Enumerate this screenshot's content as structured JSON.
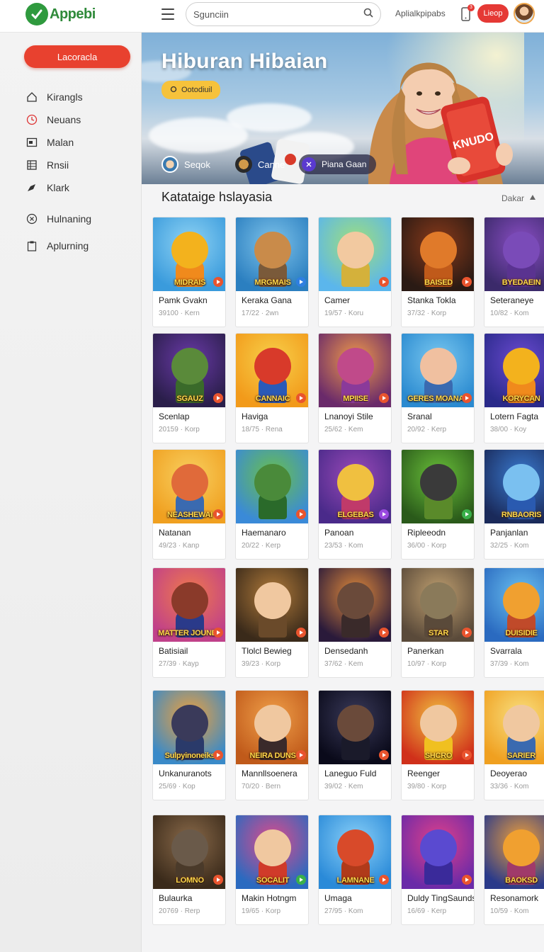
{
  "header": {
    "logo_text": "Appebi",
    "search_placeholder": "Sgunciin",
    "link_text": "Aplialkpipabs",
    "notif_count": "3",
    "button_label": "Lieop"
  },
  "sidebar": {
    "cta_label": "Lacoracla",
    "items": [
      {
        "label": "Kirangls",
        "icon": "home-icon"
      },
      {
        "label": "Neuans",
        "icon": "clock-icon"
      },
      {
        "label": "Malan",
        "icon": "window-icon"
      },
      {
        "label": "Rnsii",
        "icon": "grid-icon"
      },
      {
        "label": "Klark",
        "icon": "tag-icon"
      },
      {
        "label": "Hulnaning",
        "icon": "x-circle-icon"
      },
      {
        "label": "Aplurning",
        "icon": "clipboard-icon"
      }
    ]
  },
  "hero": {
    "title": "Hiburan Hibaian",
    "badge": "Ootodiuil",
    "phone_text": "KNUDO",
    "chips": [
      "Seqok",
      "Canne",
      "Piana Gaan"
    ]
  },
  "section": {
    "title": "Katataige hslayasia",
    "more_label": "Dakar"
  },
  "games": [
    {
      "name": "Pamk Gvakn",
      "meta": "39100 · Kern",
      "art": "MIDRAIS",
      "c1": "#3a9bdc",
      "c2": "#8fd3f4",
      "fig": "#f3b21d",
      "body": "#f08a1c",
      "play": "#e9542e"
    },
    {
      "name": "Keraka Gana",
      "meta": "17/22 · 2wn",
      "art": "MRGMAIS",
      "c1": "#2b7fc0",
      "c2": "#7ec3ea",
      "fig": "#c98b4a",
      "body": "#7a5a3a",
      "play": "#2f7fe0"
    },
    {
      "name": "Camer",
      "meta": "19/57 · Koru",
      "art": "",
      "c1": "#5bb6ec",
      "c2": "#9fdf7a",
      "fig": "#f2c9a0",
      "body": "#d4b13b",
      "play": "#e9542e"
    },
    {
      "name": "Stanka Tokla",
      "meta": "37/32 · Korp",
      "art": "BAISED",
      "c1": "#2a1a14",
      "c2": "#8a3a1a",
      "fig": "#e07a2a",
      "body": "#c05a1a",
      "play": "#e9542e"
    },
    {
      "name": "Seteraneye",
      "meta": "10/82 · Kom",
      "art": "BYEDAEIN",
      "c1": "#3b2a6a",
      "c2": "#8a4ec4",
      "fig": "#7a4bb8",
      "body": "#5a3390",
      "play": "#7a4be0"
    },
    {
      "name": "Scenlap",
      "meta": "20159 · Korp",
      "art": "SGAUZ",
      "c1": "#2a1e4a",
      "c2": "#6a3aa8",
      "fig": "#5a8a3a",
      "body": "#3a6a2a",
      "play": "#e9542e"
    },
    {
      "name": "Haviga",
      "meta": "18/75 · Rena",
      "art": "CANNAIC",
      "c1": "#f29a1a",
      "c2": "#f7d04a",
      "fig": "#d83a2a",
      "body": "#2a5ab8",
      "play": "#e9542e"
    },
    {
      "name": "Lnanoyi Stile",
      "meta": "25/62 · Kem",
      "art": "MPIISE",
      "c1": "#6a2a6a",
      "c2": "#f09a4a",
      "fig": "#c04a8a",
      "body": "#8a3a9a",
      "play": "#e9542e"
    },
    {
      "name": "Sranal",
      "meta": "20/92 · Kerp",
      "art": "GERES MOANAN",
      "c1": "#2a8ad0",
      "c2": "#7ac8f0",
      "fig": "#f0c0a0",
      "body": "#3a6ab0",
      "play": "#e9542e"
    },
    {
      "name": "Lotern Fagta",
      "meta": "38/00 · Koy",
      "art": "KORYCAN",
      "c1": "#2a2a8a",
      "c2": "#6a4ad0",
      "fig": "#f3b21d",
      "body": "#f08a1c",
      "play": "#e9542e"
    },
    {
      "name": "Natanan",
      "meta": "49/23 · Kanp",
      "art": "NEASHEWAI",
      "c1": "#f0a020",
      "c2": "#f8d060",
      "fig": "#e06a3a",
      "body": "#3a6ab0",
      "play": "#e9542e"
    },
    {
      "name": "Haemanaro",
      "meta": "20/22 · Kerp",
      "art": "",
      "c1": "#3a8ad8",
      "c2": "#6ac04a",
      "fig": "#4a8a3a",
      "body": "#2a6a2a",
      "play": "#e9542e"
    },
    {
      "name": "Panoan",
      "meta": "23/53 · Kom",
      "art": "ELGEBAS",
      "c1": "#4a2a8a",
      "c2": "#9a4ab8",
      "fig": "#f0c040",
      "body": "#c03a6a",
      "play": "#9a4ae0"
    },
    {
      "name": "Ripleeodn",
      "meta": "36/00 · Korp",
      "art": "",
      "c1": "#2a5a1a",
      "c2": "#6ac03a",
      "fig": "#3a3a3a",
      "body": "#5a8a2a",
      "play": "#3ab04a"
    },
    {
      "name": "Panjanlan",
      "meta": "32/25 · Kom",
      "art": "RNBAORIS",
      "c1": "#1a2a5a",
      "c2": "#3a7ad0",
      "fig": "#7ac0f0",
      "body": "#2a5ab0",
      "play": "#e9542e"
    },
    {
      "name": "Batisiail",
      "meta": "27/39 · Kayp",
      "art": "MATTER JOUNES",
      "c1": "#c0408a",
      "c2": "#f07a4a",
      "fig": "#8a3a2a",
      "body": "#2a3a8a",
      "play": "#e9542e"
    },
    {
      "name": "Tlolcl Bewieg",
      "meta": "39/23 · Korp",
      "art": "",
      "c1": "#3a2a1a",
      "c2": "#b07a3a",
      "fig": "#f0c8a0",
      "body": "#6a4a2a",
      "play": "#e9542e"
    },
    {
      "name": "Densedanh",
      "meta": "37/62 · Kem",
      "art": "",
      "c1": "#2a1a3a",
      "c2": "#e08a3a",
      "fig": "#6a4a3a",
      "body": "#3a2a2a",
      "play": "#e9542e"
    },
    {
      "name": "Panerkan",
      "meta": "10/97 · Korp",
      "art": "STAR",
      "c1": "#5a4a3a",
      "c2": "#c0a070",
      "fig": "#8a7a5a",
      "body": "#5a4a3a",
      "play": "#e9542e"
    },
    {
      "name": "Svarrala",
      "meta": "37/39 · Kom",
      "art": "DUISIDIE",
      "c1": "#2a6ac0",
      "c2": "#6ac0f0",
      "fig": "#f0a030",
      "body": "#c04a2a",
      "play": "#e9542e"
    },
    {
      "name": "Unkanuranots",
      "meta": "25/69 · Kop",
      "art": "Sulpyinoneiks",
      "c1": "#3a8ac8",
      "c2": "#f0a03a",
      "fig": "#3a3a5a",
      "body": "#2a3a6a",
      "play": "#e9542e"
    },
    {
      "name": "Mannllsoenera",
      "meta": "70/20 · Bern",
      "art": "NEIRA DUNS",
      "c1": "#c05a1a",
      "c2": "#f0a04a",
      "fig": "#f0c8a0",
      "body": "#3a2a2a",
      "play": "#e9542e"
    },
    {
      "name": "Laneguo Fuld",
      "meta": "39/02 · Kem",
      "art": "",
      "c1": "#0a0a1a",
      "c2": "#3a3a5a",
      "fig": "#6a4a3a",
      "body": "#1a1a2a",
      "play": "#e9542e"
    },
    {
      "name": "Reenger",
      "meta": "39/80 · Korp",
      "art": "SHCRO",
      "c1": "#d0301a",
      "c2": "#f0c040",
      "fig": "#f0c8a0",
      "body": "#f0c020",
      "play": "#e9542e"
    },
    {
      "name": "Deoyerao",
      "meta": "33/36 · Kom",
      "art": "SARIER",
      "c1": "#f0a020",
      "c2": "#f8e080",
      "fig": "#f0c8a0",
      "body": "#3a6ab0",
      "play": "#e9542e"
    },
    {
      "name": "Bulaurka",
      "meta": "20769 · Rerp",
      "art": "LOMNO",
      "c1": "#3a2a1a",
      "c2": "#8a6a4a",
      "fig": "#6a5a4a",
      "body": "#4a3a2a",
      "play": "#e9542e"
    },
    {
      "name": "Makin Hotngm",
      "meta": "19/65 · Korp",
      "art": "SOCALIT",
      "c1": "#2a6ac0",
      "c2": "#e04a8a",
      "fig": "#f0c8a0",
      "body": "#d03a2a",
      "play": "#3ab04a"
    },
    {
      "name": "Umaga",
      "meta": "27/95 · Kom",
      "art": "LAMNANE",
      "c1": "#2a8ad8",
      "c2": "#8ad0f8",
      "fig": "#d84a2a",
      "body": "#b03a1a",
      "play": "#e9542e"
    },
    {
      "name": "Duldy TingSaunds",
      "meta": "16/69 · Kerp",
      "art": "",
      "c1": "#6a2aa8",
      "c2": "#e0408a",
      "fig": "#5a4ad0",
      "body": "#3a2a9a",
      "play": "#e9542e"
    },
    {
      "name": "Resonamork",
      "meta": "10/59 · Kom",
      "art": "BAOKSD",
      "c1": "#2a3a8a",
      "c2": "#f0a03a",
      "fig": "#f0a030",
      "body": "#a03a6a",
      "play": "#e9542e"
    }
  ]
}
